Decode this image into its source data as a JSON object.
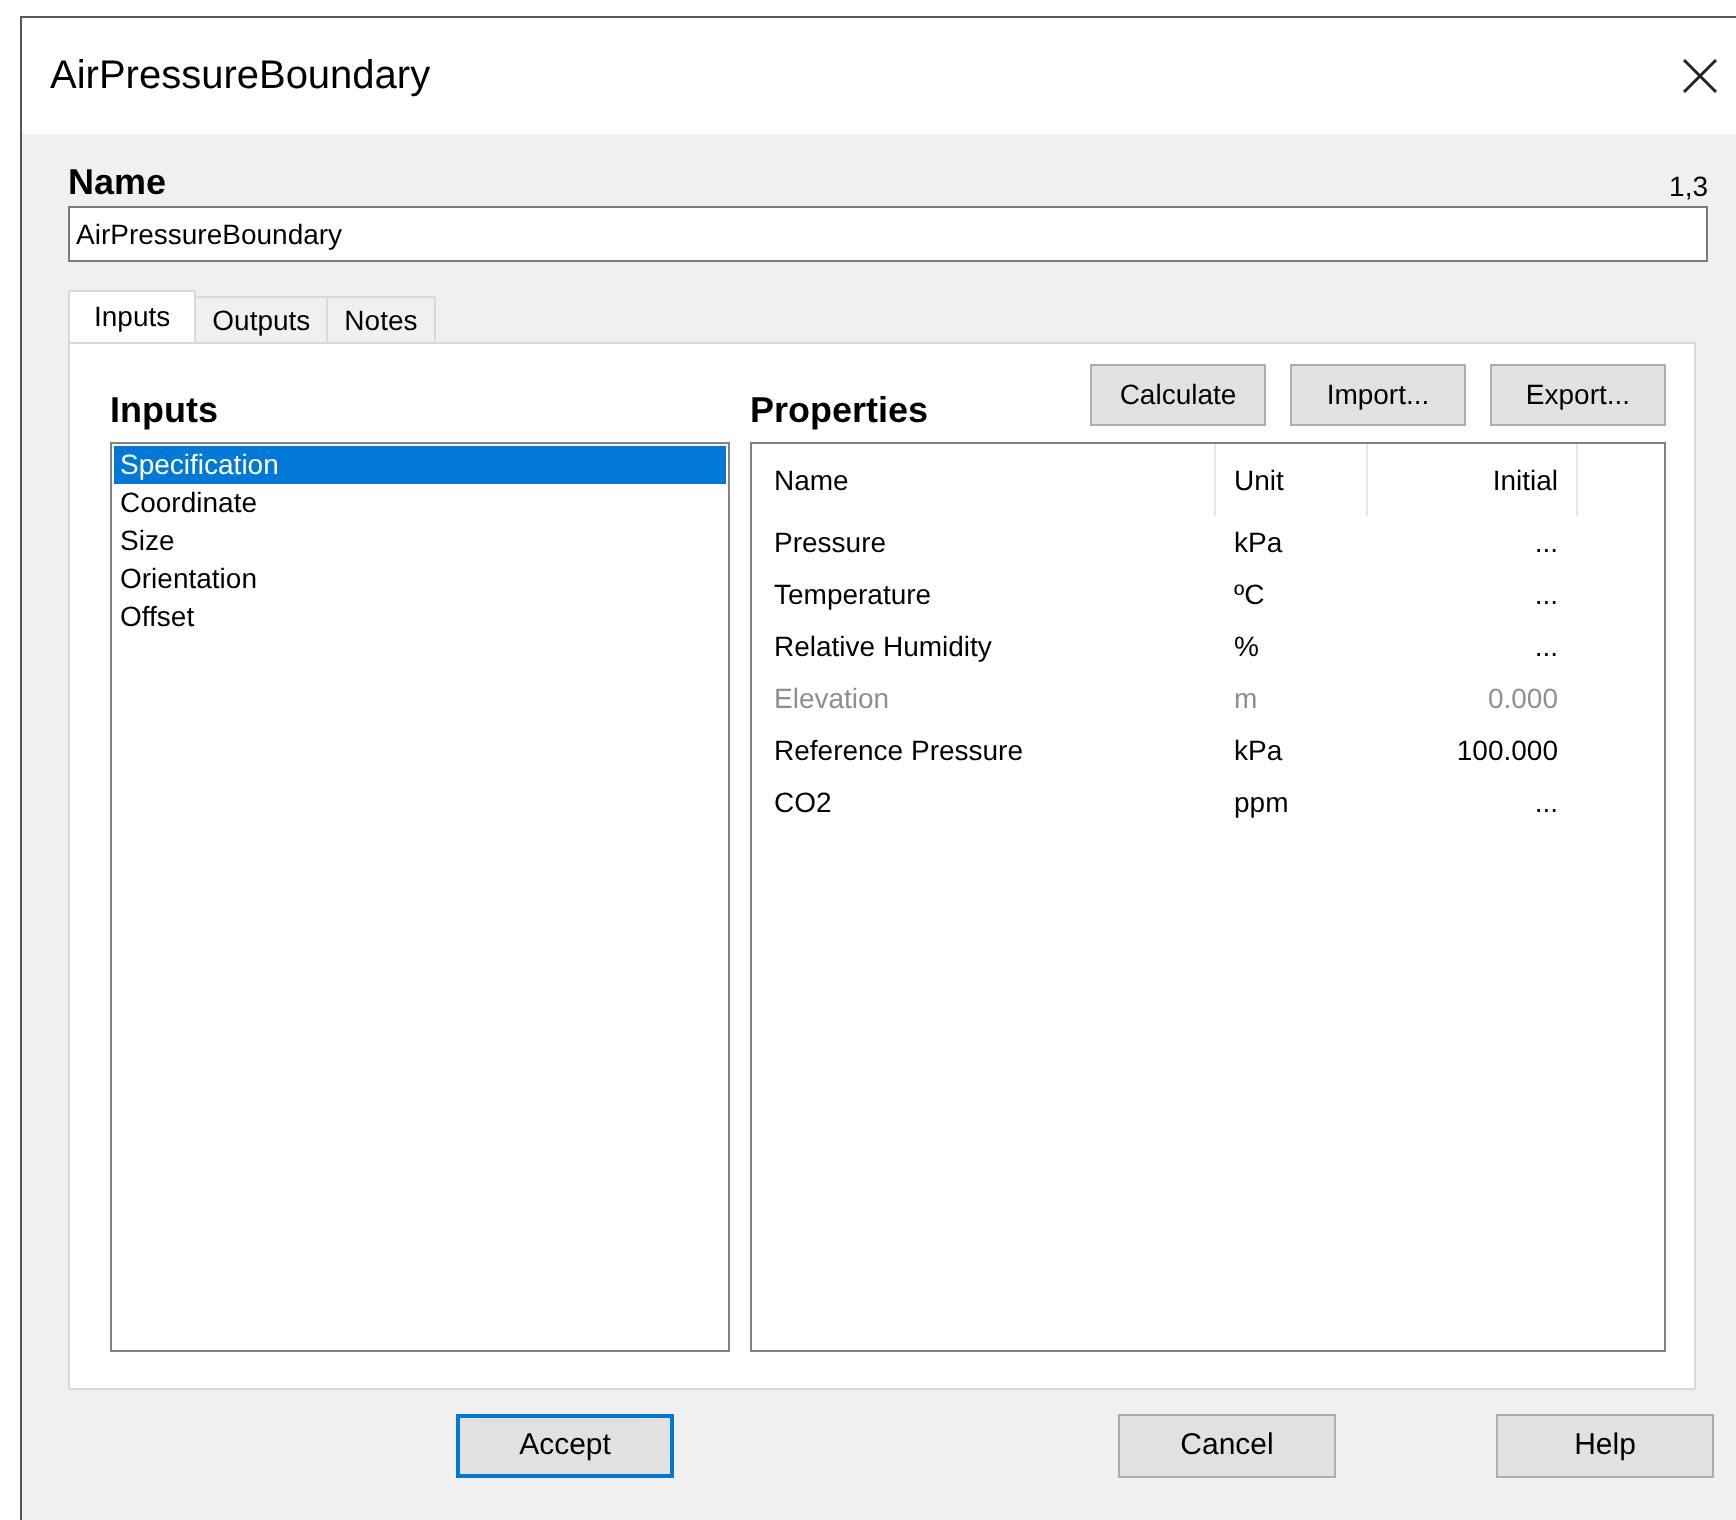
{
  "window": {
    "title": "AirPressureBoundary"
  },
  "name": {
    "label": "Name",
    "version": "1,3",
    "value": "AirPressureBoundary"
  },
  "tabs": [
    {
      "label": "Inputs",
      "selected": true
    },
    {
      "label": "Outputs",
      "selected": false
    },
    {
      "label": "Notes",
      "selected": false
    }
  ],
  "inputs": {
    "title": "Inputs",
    "items": [
      {
        "label": "Specification",
        "selected": true
      },
      {
        "label": "Coordinate",
        "selected": false
      },
      {
        "label": "Size",
        "selected": false
      },
      {
        "label": "Orientation",
        "selected": false
      },
      {
        "label": "Offset",
        "selected": false
      }
    ]
  },
  "properties": {
    "title": "Properties",
    "buttons": [
      "Calculate",
      "Import...",
      "Export..."
    ],
    "columns": [
      "Name",
      "Unit",
      "Initial"
    ],
    "rows": [
      {
        "name": "Pressure",
        "unit": "kPa",
        "initial": "...",
        "disabled": false
      },
      {
        "name": "Temperature",
        "unit": "ºC",
        "initial": "...",
        "disabled": false
      },
      {
        "name": "Relative Humidity",
        "unit": "%",
        "initial": "...",
        "disabled": false
      },
      {
        "name": "Elevation",
        "unit": "m",
        "initial": "0.000",
        "disabled": true
      },
      {
        "name": "Reference Pressure",
        "unit": "kPa",
        "initial": "100.000",
        "disabled": false
      },
      {
        "name": "CO2",
        "unit": "ppm",
        "initial": "...",
        "disabled": false
      }
    ]
  },
  "footer_buttons": [
    {
      "label": "Accept",
      "default": true
    },
    {
      "label": "Cancel",
      "default": false
    },
    {
      "label": "Help",
      "default": false
    }
  ]
}
